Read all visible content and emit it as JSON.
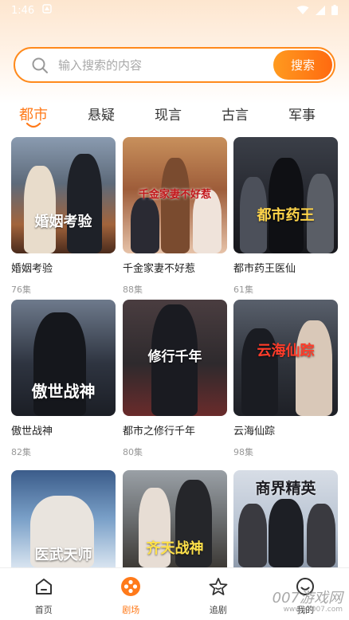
{
  "status_bar": {
    "time": "1:46"
  },
  "search": {
    "placeholder": "输入搜索的内容",
    "button_label": "搜索"
  },
  "tabs": [
    {
      "label": "都市",
      "active": true
    },
    {
      "label": "悬疑",
      "active": false
    },
    {
      "label": "现言",
      "active": false
    },
    {
      "label": "古言",
      "active": false
    },
    {
      "label": "军事",
      "active": false
    }
  ],
  "dramas": [
    {
      "title": "婚姻考验",
      "episodes": "76集",
      "poster_text": "婚姻考验"
    },
    {
      "title": "千金家妻不好惹",
      "episodes": "88集",
      "poster_text": "千金家妻不好惹"
    },
    {
      "title": "都市药王医仙",
      "episodes": "61集",
      "poster_text": "都市药王"
    },
    {
      "title": "傲世战神",
      "episodes": "82集",
      "poster_text": "傲世战神"
    },
    {
      "title": "都市之修行千年",
      "episodes": "80集",
      "poster_text": "修行千年"
    },
    {
      "title": "云海仙踪",
      "episodes": "98集",
      "poster_text": "云海仙踪"
    },
    {
      "poster_text": "医武天师"
    },
    {
      "poster_text": "齐天战神"
    },
    {
      "poster_text": "商界精英"
    }
  ],
  "bottom_nav": [
    {
      "label": "首页",
      "icon": "home-icon",
      "active": false
    },
    {
      "label": "剧场",
      "icon": "theater-reel-icon",
      "active": true
    },
    {
      "label": "追剧",
      "icon": "star-tv-icon",
      "active": false
    },
    {
      "label": "我的",
      "icon": "profile-icon",
      "active": false
    }
  ],
  "watermark": {
    "text": "007游戏网",
    "sub": "www.y3007.com"
  },
  "colors": {
    "accent": "#ff7a1a",
    "search_border": "#ff8a1c"
  }
}
